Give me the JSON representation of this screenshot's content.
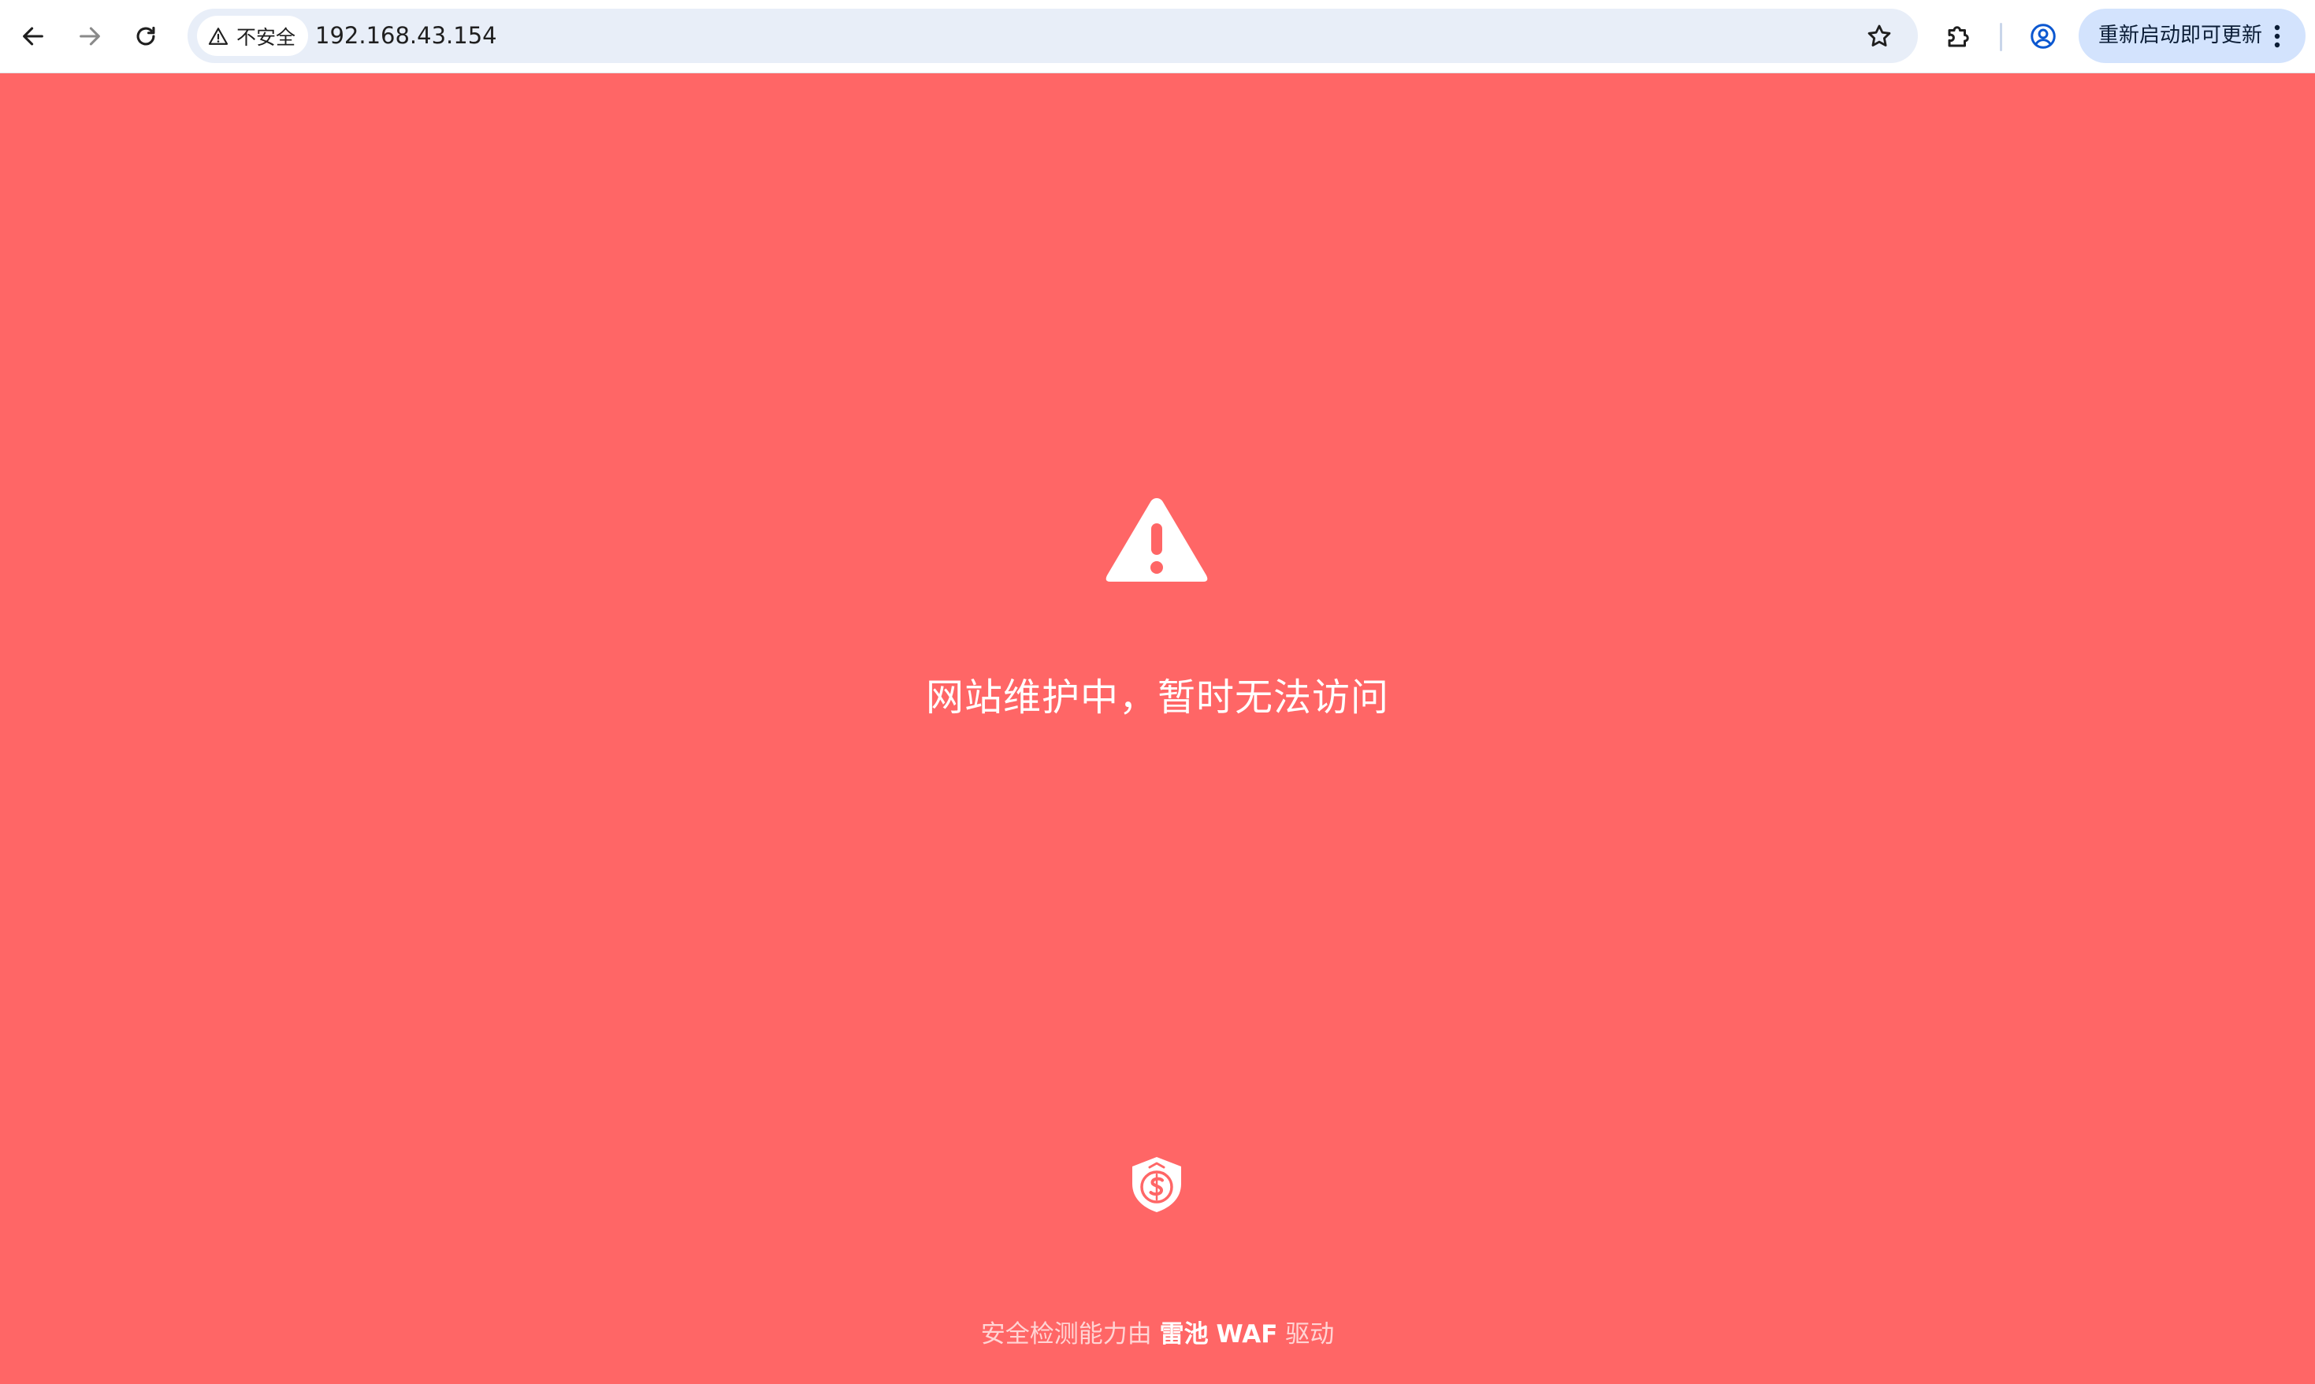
{
  "browser": {
    "security_chip_label": "不安全",
    "address": "192.168.43.154",
    "update_button_label": "重新启动即可更新",
    "icons": {
      "back": "back-arrow-icon",
      "forward": "forward-arrow-icon",
      "reload": "reload-icon",
      "warning": "warning-triangle-icon",
      "bookmark": "star-icon",
      "extensions": "puzzle-piece-icon",
      "profile": "profile-icon",
      "menu": "three-dot-menu-icon"
    }
  },
  "block_page": {
    "background_color": "#ff6666",
    "headline": "网站维护中，暂时无法访问",
    "footer_prefix": "安全检测能力由",
    "footer_brand": "雷池",
    "footer_product": "WAF",
    "footer_suffix": "驱动",
    "icons": {
      "alert": "warning-triangle-icon",
      "logo": "safeline-shield-logo"
    }
  }
}
